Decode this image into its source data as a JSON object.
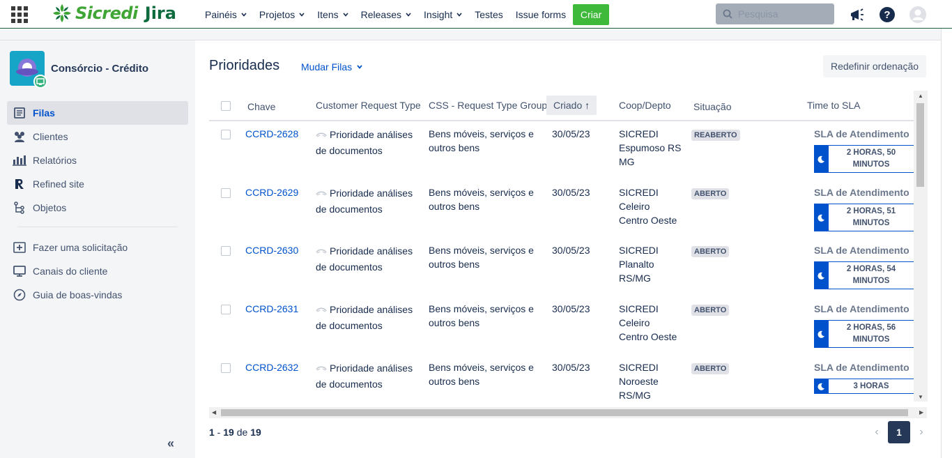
{
  "topnav": {
    "brand": "Sicredi",
    "product": "Jira",
    "menu": [
      {
        "label": "Painéis",
        "dropdown": true
      },
      {
        "label": "Projetos",
        "dropdown": true
      },
      {
        "label": "Itens",
        "dropdown": true
      },
      {
        "label": "Releases",
        "dropdown": true
      },
      {
        "label": "Insight",
        "dropdown": true
      },
      {
        "label": "Testes",
        "dropdown": false
      },
      {
        "label": "Issue forms",
        "dropdown": false
      }
    ],
    "create_label": "Criar",
    "search_placeholder": "Pesquisa",
    "icons": [
      "apps-grid-icon",
      "announcement-icon",
      "help-icon",
      "user-avatar-icon"
    ]
  },
  "sidebar": {
    "project_name": "Consórcio - Crédito",
    "items": [
      {
        "label": "Filas",
        "icon": "queues-icon",
        "active": true
      },
      {
        "label": "Clientes",
        "icon": "customers-icon",
        "active": false
      },
      {
        "label": "Relatórios",
        "icon": "reports-icon",
        "active": false
      },
      {
        "label": "Refined site",
        "icon": "refined-icon",
        "active": false
      },
      {
        "label": "Objetos",
        "icon": "objects-icon",
        "active": false
      }
    ],
    "secondary_items": [
      {
        "label": "Fazer uma solicitação",
        "icon": "add-request-icon"
      },
      {
        "label": "Canais do cliente",
        "icon": "monitor-icon"
      },
      {
        "label": "Guia de boas-vindas",
        "icon": "compass-icon"
      }
    ],
    "collapse_label": "«"
  },
  "main": {
    "title": "Prioridades",
    "change_queue_label": "Mudar Filas",
    "reset_sort_label": "Redefinir ordenação",
    "columns": [
      "Chave",
      "Customer Request Type",
      "CSS - Request Type Group",
      "Criado",
      "Coop/Depto",
      "Situação",
      "Time to SLA"
    ],
    "sorted_column_arrow": "↑",
    "rows": [
      {
        "key": "CCRD-2628",
        "request_type_line1": "Prioridade análises",
        "request_type_line2": "de documentos",
        "group_line1": "Bens móveis, serviços e",
        "group_line2": "outros bens",
        "created": "30/05/23",
        "coop": [
          "SICREDI",
          "Espumoso RS",
          "MG"
        ],
        "status": "REABERTO",
        "sla_name": "SLA de Atendimento",
        "sla_line1": "2 HORAS, 50",
        "sla_line2": "MINUTOS"
      },
      {
        "key": "CCRD-2629",
        "request_type_line1": "Prioridade análises",
        "request_type_line2": "de documentos",
        "group_line1": "Bens móveis, serviços e",
        "group_line2": "outros bens",
        "created": "30/05/23",
        "coop": [
          "SICREDI",
          "Celeiro",
          "Centro Oeste"
        ],
        "status": "ABERTO",
        "sla_name": "SLA de Atendimento",
        "sla_line1": "2 HORAS, 51",
        "sla_line2": "MINUTOS"
      },
      {
        "key": "CCRD-2630",
        "request_type_line1": "Prioridade análises",
        "request_type_line2": "de documentos",
        "group_line1": "Bens móveis, serviços e",
        "group_line2": "outros bens",
        "created": "30/05/23",
        "coop": [
          "SICREDI",
          "Planalto",
          "RS/MG"
        ],
        "status": "ABERTO",
        "sla_name": "SLA de Atendimento",
        "sla_line1": "2 HORAS, 54",
        "sla_line2": "MINUTOS"
      },
      {
        "key": "CCRD-2631",
        "request_type_line1": "Prioridade análises",
        "request_type_line2": "de documentos",
        "group_line1": "Bens móveis, serviços e",
        "group_line2": "outros bens",
        "created": "30/05/23",
        "coop": [
          "SICREDI",
          "Celeiro",
          "Centro Oeste"
        ],
        "status": "ABERTO",
        "sla_name": "SLA de Atendimento",
        "sla_line1": "2 HORAS, 56",
        "sla_line2": "MINUTOS"
      },
      {
        "key": "CCRD-2632",
        "request_type_line1": "Prioridade análises",
        "request_type_line2": "de documentos",
        "group_line1": "Bens móveis, serviços e",
        "group_line2": "outros bens",
        "created": "30/05/23",
        "coop": [
          "SICREDI",
          "Noroeste",
          "RS/MG"
        ],
        "status": "ABERTO",
        "sla_name": "SLA de Atendimento",
        "sla_line1": "3 HORAS",
        "sla_line2": ""
      }
    ],
    "pagination": {
      "from": "1",
      "to": "19",
      "of_label": "de",
      "total": "19",
      "current_page": "1",
      "prev": "‹",
      "next": "›"
    }
  },
  "colors": {
    "brand_green": "#3fa535",
    "create_green": "#3fb93a",
    "link_blue": "#0052cc",
    "sidebar_bg": "#f4f5f7"
  }
}
